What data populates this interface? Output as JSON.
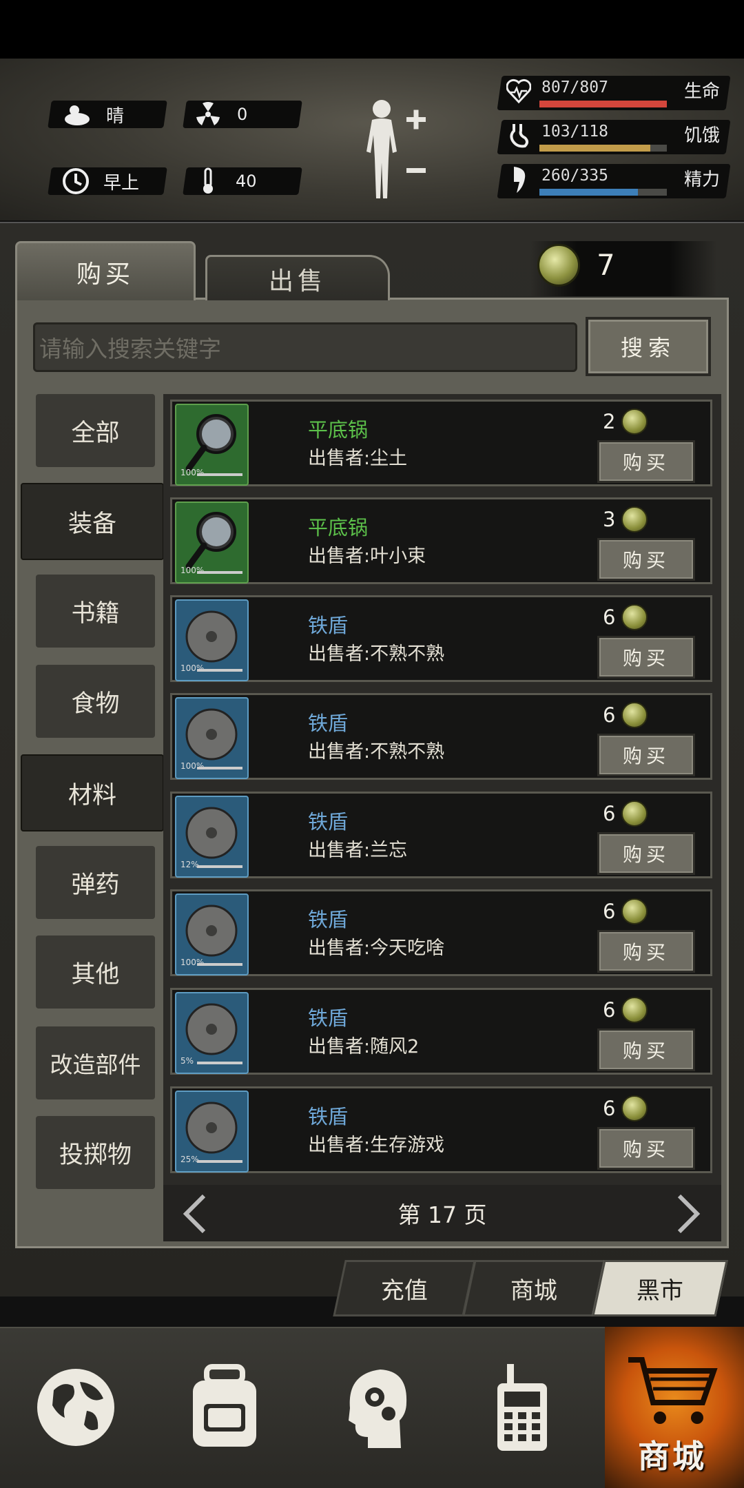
{
  "header": {
    "weather": "晴",
    "radiation": "0",
    "time_of_day": "早上",
    "temperature": "40",
    "stats": [
      {
        "label": "生命",
        "value": "807/807",
        "fraction": 1.0,
        "color": "#d4463c"
      },
      {
        "label": "饥饿",
        "value": "103/118",
        "fraction": 0.873,
        "color": "#c29c4a"
      },
      {
        "label": "精力",
        "value": "260/335",
        "fraction": 0.776,
        "color": "#3d7fb8"
      }
    ]
  },
  "tabs": {
    "buy": "购买",
    "sell": "出售"
  },
  "currency": {
    "amount": "7",
    "icon": "bottle-cap-icon"
  },
  "search": {
    "placeholder": "请输入搜索关键字",
    "button": "搜索"
  },
  "categories": [
    {
      "label": "全部",
      "active": false
    },
    {
      "label": "装备",
      "active": true
    },
    {
      "label": "书籍",
      "active": false
    },
    {
      "label": "食物",
      "active": false
    },
    {
      "label": "材料",
      "active": true
    },
    {
      "label": "弹药",
      "active": false
    },
    {
      "label": "其他",
      "active": false
    },
    {
      "label": "改造部件",
      "active": false
    },
    {
      "label": "投掷物",
      "active": false
    }
  ],
  "items": [
    {
      "name": "平底锅",
      "seller": "出售者:尘土",
      "price": "2",
      "durability": "100%",
      "durability_fraction": 1.0,
      "rarity": "green",
      "icon": "frying-pan-icon",
      "buy": "购买"
    },
    {
      "name": "平底锅",
      "seller": "出售者:叶小束",
      "price": "3",
      "durability": "100%",
      "durability_fraction": 1.0,
      "rarity": "green",
      "icon": "frying-pan-icon",
      "buy": "购买"
    },
    {
      "name": "铁盾",
      "seller": "出售者:不熟不熟",
      "price": "6",
      "durability": "100%",
      "durability_fraction": 1.0,
      "rarity": "blue",
      "icon": "iron-shield-icon",
      "buy": "购买"
    },
    {
      "name": "铁盾",
      "seller": "出售者:不熟不熟",
      "price": "6",
      "durability": "100%",
      "durability_fraction": 1.0,
      "rarity": "blue",
      "icon": "iron-shield-icon",
      "buy": "购买"
    },
    {
      "name": "铁盾",
      "seller": "出售者:兰忘",
      "price": "6",
      "durability": "12%",
      "durability_fraction": 0.12,
      "rarity": "blue",
      "icon": "iron-shield-icon",
      "buy": "购买"
    },
    {
      "name": "铁盾",
      "seller": "出售者:今天吃啥",
      "price": "6",
      "durability": "100%",
      "durability_fraction": 1.0,
      "rarity": "blue",
      "icon": "iron-shield-icon",
      "buy": "购买"
    },
    {
      "name": "铁盾",
      "seller": "出售者:随风2",
      "price": "6",
      "durability": "5%",
      "durability_fraction": 0.05,
      "rarity": "blue",
      "icon": "iron-shield-icon",
      "buy": "购买"
    },
    {
      "name": "铁盾",
      "seller": "出售者:生存游戏",
      "price": "6",
      "durability": "25%",
      "durability_fraction": 0.25,
      "rarity": "blue",
      "icon": "iron-shield-icon",
      "buy": "购买"
    }
  ],
  "pager": {
    "label": "第 17 页"
  },
  "shop_tabs": [
    {
      "label": "充值",
      "active": false
    },
    {
      "label": "商城",
      "active": false
    },
    {
      "label": "黑市",
      "active": true
    }
  ],
  "bottom_nav": [
    {
      "icon": "globe-icon"
    },
    {
      "icon": "backpack-icon"
    },
    {
      "icon": "head-gears-icon"
    },
    {
      "icon": "walkie-talkie-icon"
    },
    {
      "icon": "shopping-cart-icon",
      "label": "商城"
    }
  ]
}
